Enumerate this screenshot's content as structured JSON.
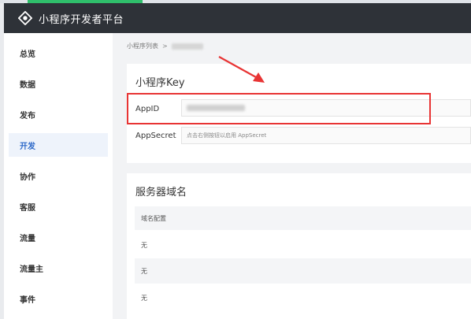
{
  "header": {
    "brand": "小程序开发者平台",
    "logo_icon": "brand-logo-icon"
  },
  "sidebar": {
    "items": [
      {
        "label": "总览"
      },
      {
        "label": "数据"
      },
      {
        "label": "发布"
      },
      {
        "label": "开发",
        "active": true
      },
      {
        "label": "协作"
      },
      {
        "label": "客服"
      },
      {
        "label": "流量"
      },
      {
        "label": "流量主"
      },
      {
        "label": "事件"
      }
    ]
  },
  "breadcrumb": {
    "root": "小程序列表",
    "separator": ">"
  },
  "key_card": {
    "title": "小程序Key",
    "appid_label": "AppID",
    "appsecret_label": "AppSecret",
    "appsecret_hint": "点击右侧按钮以启用 AppSecret"
  },
  "domain_card": {
    "title": "服务器域名",
    "column_header": "域名配置",
    "rows": [
      "无",
      "无",
      "无"
    ]
  },
  "colors": {
    "annotation": "#e83434",
    "active_nav": "#2e6ac9",
    "header_bg": "#2e3238"
  }
}
